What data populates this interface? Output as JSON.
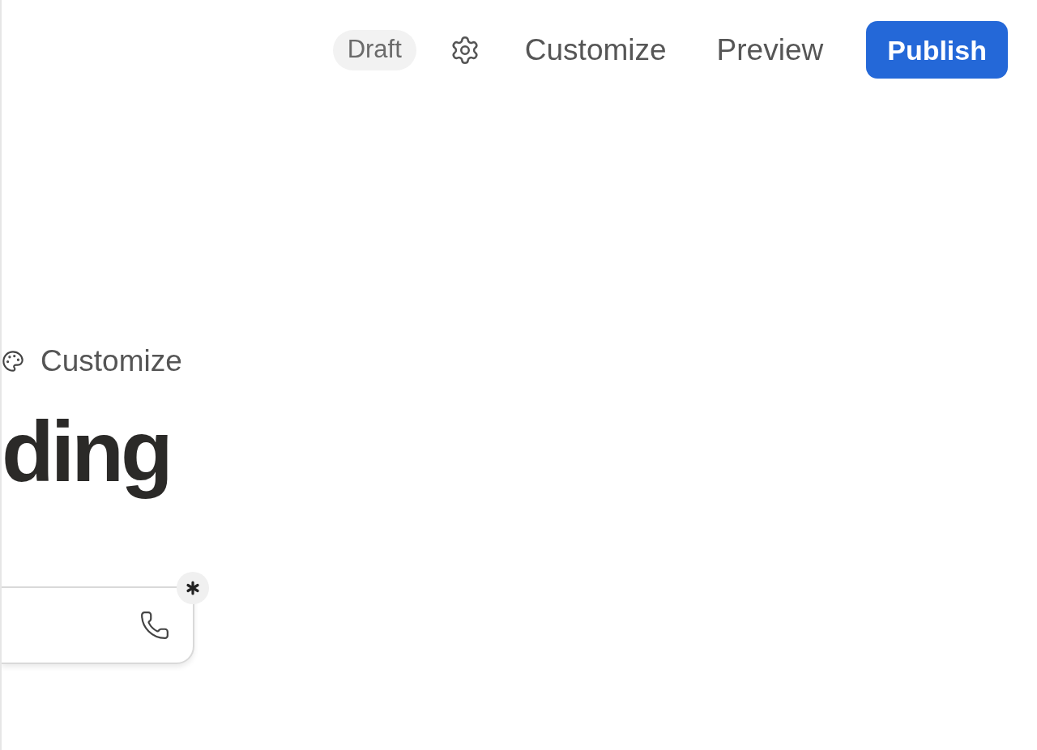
{
  "header": {
    "status": "Draft",
    "actions": [
      {
        "label": "Customize",
        "kind": "link"
      },
      {
        "label": "Preview",
        "kind": "link"
      },
      {
        "label": "Publish",
        "kind": "primary"
      }
    ]
  },
  "editor": {
    "toolbar_label": "Customize",
    "heading": "ding",
    "field": {
      "required": true
    }
  }
}
